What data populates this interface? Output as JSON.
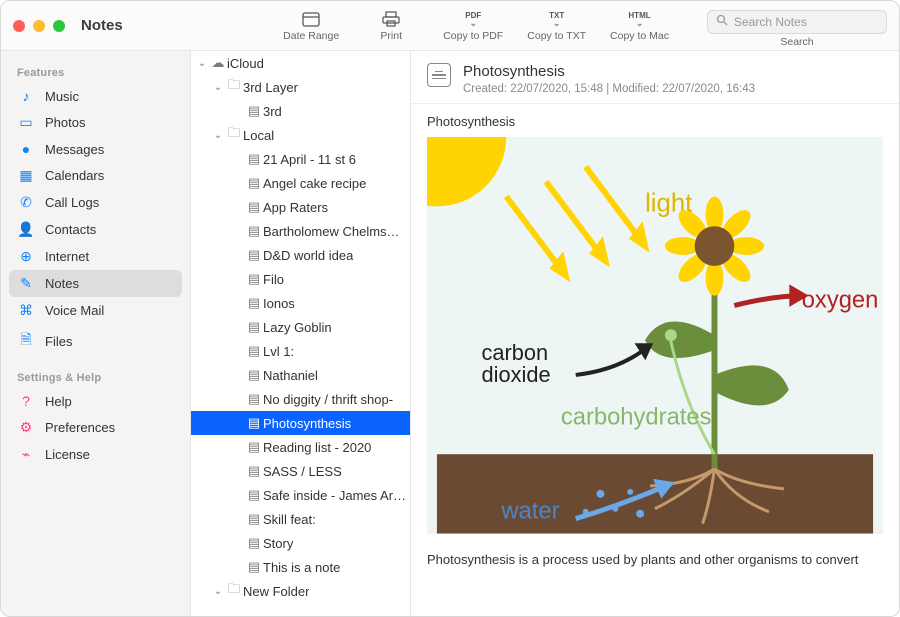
{
  "app_title": "Notes",
  "toolbar": {
    "date_range": "Date Range",
    "print": "Print",
    "copy_pdf_badge": "PDF",
    "copy_pdf": "Copy to PDF",
    "copy_txt_badge": "TXT",
    "copy_txt": "Copy to TXT",
    "copy_mac_badge": "HTML",
    "copy_mac": "Copy to Mac",
    "search_placeholder": "Search Notes",
    "search_label": "Search"
  },
  "sidebar": {
    "section_features": "Features",
    "section_settings": "Settings & Help",
    "items_features": [
      {
        "icon": "music-icon",
        "label": "Music",
        "color": "c-blue"
      },
      {
        "icon": "photos-icon",
        "label": "Photos",
        "color": "c-blue"
      },
      {
        "icon": "messages-icon",
        "label": "Messages",
        "color": "c-blue"
      },
      {
        "icon": "calendars-icon",
        "label": "Calendars",
        "color": "c-blue"
      },
      {
        "icon": "calllogs-icon",
        "label": "Call Logs",
        "color": "c-blue"
      },
      {
        "icon": "contacts-icon",
        "label": "Contacts",
        "color": "c-blue"
      },
      {
        "icon": "internet-icon",
        "label": "Internet",
        "color": "c-blue"
      },
      {
        "icon": "notes-icon",
        "label": "Notes",
        "color": "c-blue",
        "selected": true
      },
      {
        "icon": "voicemail-icon",
        "label": "Voice Mail",
        "color": "c-blue"
      },
      {
        "icon": "files-icon",
        "label": "Files",
        "color": "c-blue"
      }
    ],
    "items_settings": [
      {
        "icon": "help-icon",
        "label": "Help",
        "color": "c-pink"
      },
      {
        "icon": "preferences-icon",
        "label": "Preferences",
        "color": "c-pink"
      },
      {
        "icon": "license-icon",
        "label": "License",
        "color": "c-pink"
      }
    ]
  },
  "tree": {
    "nodes": [
      {
        "depth": 0,
        "expandable": true,
        "open": true,
        "type": "cloud",
        "label": "iCloud"
      },
      {
        "depth": 1,
        "expandable": true,
        "open": true,
        "type": "folder",
        "label": "3rd Layer"
      },
      {
        "depth": 2,
        "expandable": false,
        "type": "note",
        "label": "3rd"
      },
      {
        "depth": 1,
        "expandable": true,
        "open": true,
        "type": "folder",
        "label": "Local"
      },
      {
        "depth": 2,
        "type": "note",
        "label": "21 April - 11 st 6"
      },
      {
        "depth": 2,
        "type": "note",
        "label": "Angel cake recipe"
      },
      {
        "depth": 2,
        "type": "note",
        "label": "App Raters"
      },
      {
        "depth": 2,
        "type": "note",
        "label": "Bartholomew Chelms…"
      },
      {
        "depth": 2,
        "type": "note",
        "label": "D&D world idea"
      },
      {
        "depth": 2,
        "type": "note",
        "label": "Filo"
      },
      {
        "depth": 2,
        "type": "note",
        "label": "Ionos"
      },
      {
        "depth": 2,
        "type": "note",
        "label": "Lazy Goblin"
      },
      {
        "depth": 2,
        "type": "note",
        "label": "Lvl 1:"
      },
      {
        "depth": 2,
        "type": "note",
        "label": "Nathaniel"
      },
      {
        "depth": 2,
        "type": "note",
        "label": "No diggity / thrift shop-"
      },
      {
        "depth": 2,
        "type": "note",
        "label": "Photosynthesis",
        "selected": true
      },
      {
        "depth": 2,
        "type": "note",
        "label": "Reading list - 2020"
      },
      {
        "depth": 2,
        "type": "note",
        "label": "SASS / LESS"
      },
      {
        "depth": 2,
        "type": "note",
        "label": "Safe inside - James Ar…"
      },
      {
        "depth": 2,
        "type": "note",
        "label": "Skill feat:"
      },
      {
        "depth": 2,
        "type": "note",
        "label": "Story"
      },
      {
        "depth": 2,
        "type": "note",
        "label": "This is a note"
      },
      {
        "depth": 1,
        "expandable": true,
        "open": true,
        "type": "folder",
        "label": "New Folder"
      }
    ]
  },
  "note": {
    "title": "Photosynthesis",
    "meta": "Created: 22/07/2020, 15:48 | Modified: 22/07/2020, 16:43",
    "heading": "Photosynthesis",
    "body_text": "Photosynthesis is a process used by plants and other organisms to convert",
    "diagram_labels": {
      "light": "light",
      "oxygen": "oxygen",
      "carbon_dioxide": "carbon\ndioxide",
      "carbohydrates": "carbohydrates",
      "water": "water"
    }
  },
  "icon_glyphs": {
    "music-icon": "♪",
    "photos-icon": "▭",
    "messages-icon": "●",
    "calendars-icon": "▦",
    "calllogs-icon": "✆",
    "contacts-icon": "👤",
    "internet-icon": "⊕",
    "notes-icon": "✎",
    "voicemail-icon": "⌘",
    "files-icon": "🗎",
    "help-icon": "?",
    "preferences-icon": "⚙",
    "license-icon": "⌁",
    "cloud": "☁",
    "folder": "🗀",
    "note": "▤"
  }
}
